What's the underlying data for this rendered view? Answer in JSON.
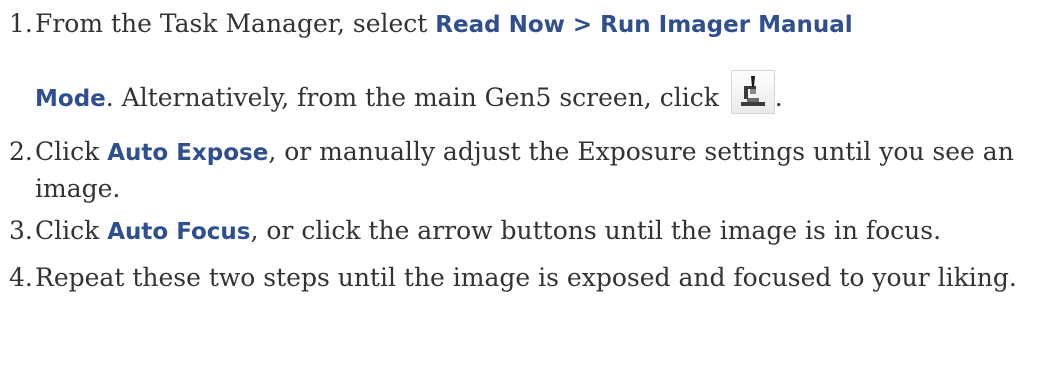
{
  "steps": [
    {
      "number": "1.",
      "line1_pre": "From the Task Manager, select ",
      "line1_ui": "Read Now > Run Imager Manual",
      "line2_ui": "Mode",
      "line2_post": ". Alternatively, from the main Gen5 screen, click ",
      "line2_end": ".",
      "icon": "microscope-icon"
    },
    {
      "number": "2.",
      "pre": "Click ",
      "ui": "Auto Expose",
      "post": ", or manually adjust the Exposure settings until you see an image."
    },
    {
      "number": "3.",
      "pre": "Click ",
      "ui": "Auto Focus",
      "post": ", or click the arrow buttons until the image is in focus."
    },
    {
      "number": "4.",
      "text": "Repeat these two steps until the image is exposed and focused to your liking."
    }
  ],
  "colors": {
    "ui_text": "#2f4f8f",
    "body_text": "#333333"
  }
}
